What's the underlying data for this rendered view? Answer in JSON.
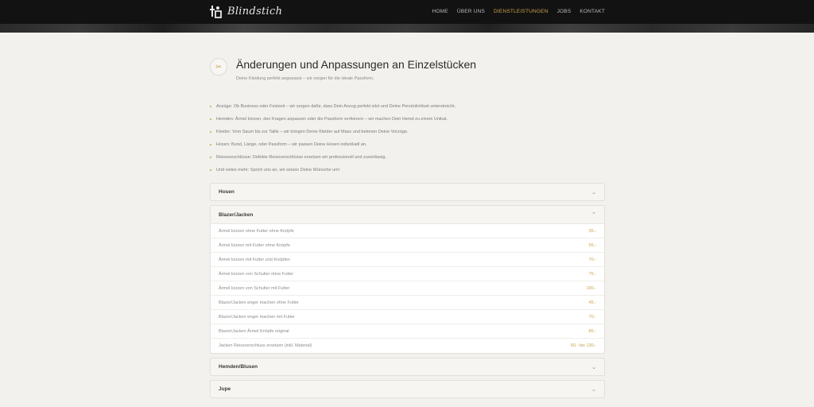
{
  "brand": {
    "name": "Blindstich",
    "mark_icon": "logo-figure-icon"
  },
  "nav": {
    "items": [
      {
        "label": "HOME",
        "active": false
      },
      {
        "label": "ÜBER UNS",
        "active": false
      },
      {
        "label": "DIENSTLEISTUNGEN",
        "active": true
      },
      {
        "label": "JOBS",
        "active": false
      },
      {
        "label": "KONTAKT",
        "active": false
      }
    ],
    "accent": "#c9a34a"
  },
  "page": {
    "icon": "scissors-icon",
    "title": "Änderungen und Anpassungen an Einzelstücken",
    "subtitle": "Deine Kleidung perfekt angepasst – wir sorgen für die ideale Passform."
  },
  "bullets": [
    "Anzüge: Ob Business oder Festzeit – wir sorgen dafür, dass Dein Anzug perfekt sitzt und Deine Persönlichkeit unterstreicht.",
    "Hemden: Ärmel kürzen, den Kragen anpassen oder die Passform verfeinern – wir machen Dein Hemd zu einem Unikat.",
    "Kleider: Vom Saum bis zur Taille – wir bringen Deine Kleider auf Mass und betonen Deine Vorzüge.",
    "Hosen: Bund, Länge, oder Passform – wir passen Deine Hosen individuell an.",
    "Reissverschlüsse: Defekte Reissverschlüsse ersetzen wir professionell und zuverlässig.",
    "Und vieles mehr: Sprich uns an, wir setzen Deine Wünsche um!"
  ],
  "accordion": {
    "sections": [
      {
        "label": "Hosen",
        "open": false
      },
      {
        "label": "Blazer/Jacken",
        "open": true
      },
      {
        "label": "Hemden/Blusen",
        "open": false
      },
      {
        "label": "Jupe",
        "open": false
      }
    ],
    "blazer_items": [
      {
        "desc": "Ärmel kürzen ohne Futter ohne Knöpfe",
        "price": "35.-"
      },
      {
        "desc": "Ärmel kürzen mit Futter ohne Knöpfe",
        "price": "55.-"
      },
      {
        "desc": "Ärmel kürzen mit Futter und Knöpfen",
        "price": "70.-"
      },
      {
        "desc": "Ärmel kürzen von Schulter ohne Futter",
        "price": "75.-"
      },
      {
        "desc": "Ärmel kürzen von Schulter mit Futter",
        "price": "100.-"
      },
      {
        "desc": "Blazer/Jacken enger machen ohne Futter",
        "price": "45.-"
      },
      {
        "desc": "Blazer/Jacken enger machen mit Futter",
        "price": "70.-"
      },
      {
        "desc": "Blazer/Jacken Ärmel Knöpfe original",
        "price": "85.-"
      },
      {
        "desc": "Jacken Reissverschluss ersetzen (inkl. Material)",
        "price": "60.- bis 130.-"
      }
    ]
  }
}
